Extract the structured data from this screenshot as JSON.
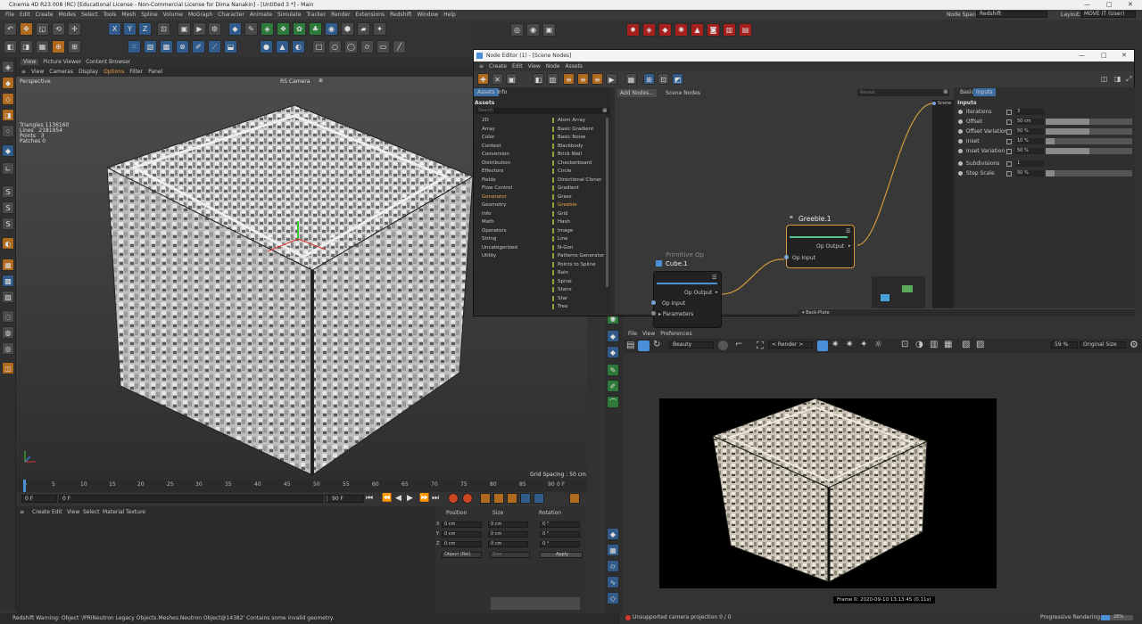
{
  "titlebar": {
    "title": "Cinema 4D R23.008 (RC) [Educational License - Non-Commercial License for Dima Nanakin] - [Untitled 3 *] - Main"
  },
  "menubar": {
    "items": [
      "File",
      "Edit",
      "Create",
      "Modes",
      "Select",
      "Tools",
      "Mesh",
      "Spline",
      "Volume",
      "MoGraph",
      "Character",
      "Animate",
      "Simulate",
      "Tracker",
      "Render",
      "Extensions",
      "Redshift",
      "Window",
      "Help"
    ],
    "node_space_label": "Node Space:",
    "node_space_value": "Redshift",
    "layout_label": "Layout:",
    "layout_value": "MOVE IT (User)"
  },
  "toolbar": {
    "axis_x": "X",
    "axis_y": "Y",
    "axis_z": "Z"
  },
  "viewport": {
    "tabs": [
      "View",
      "Picture Viewer",
      "Content Browser"
    ],
    "menu": [
      "View",
      "Cameras",
      "Display",
      "Options",
      "Filter",
      "Panel"
    ],
    "projection": "Perspective",
    "camera": "RS Camera",
    "stats": {
      "triangles_label": "Triangles",
      "triangles": "1136160",
      "lines_label": "Lines",
      "lines": "2181954",
      "points_label": "Points",
      "points": "3",
      "patches_label": "Patches",
      "patches": "0"
    },
    "grid_spacing": "Grid Spacing : 50 cm"
  },
  "timeline": {
    "ticks": [
      "0",
      "5",
      "10",
      "15",
      "20",
      "25",
      "30",
      "35",
      "40",
      "45",
      "50",
      "55",
      "60",
      "65",
      "70",
      "75",
      "80",
      "85",
      "90"
    ],
    "current_frame": "0 F",
    "start": "0 F",
    "min": "0 F",
    "max": "90 F",
    "end": "90 F"
  },
  "manager": {
    "menu": [
      "Create",
      "Edit",
      "View",
      "Select",
      "Material",
      "Texture"
    ]
  },
  "coords": {
    "headers": [
      "Position",
      "Size",
      "Rotation"
    ],
    "x_pos": "0 cm",
    "y_pos": "0 cm",
    "z_pos": "0 cm",
    "x_size": "0 cm",
    "y_size": "0 cm",
    "z_size": "0 cm",
    "h_rot": "0 °",
    "p_rot": "0 °",
    "b_rot": "0 °",
    "mode": "Object (Rel)",
    "size_mode": "Size",
    "apply": "Apply"
  },
  "statusbar": {
    "message": "Redshift Warning: Object '/PRINeutron Legacy Objects.Meshes.Neutron Object@14382' Contains some invalid geometry."
  },
  "node_editor": {
    "title": "Node Editor (1) - [Scene Nodes]",
    "menu": [
      "Create",
      "Edit",
      "View",
      "Node",
      "Assets"
    ],
    "asset_tabs": [
      "Assets",
      "Info"
    ],
    "assets_header": "Assets",
    "search_placeholder": "Search",
    "categories": [
      "2D",
      "Array",
      "Color",
      "Context",
      "Conversion",
      "Distribution",
      "Effectors",
      "Fields",
      "Flow Control",
      "Generator",
      "Geometry",
      "Info",
      "Math",
      "Operators",
      "String",
      "Uncategorized",
      "Utility"
    ],
    "items": [
      "Atom Array",
      "Basic Gradient",
      "Basic Noise",
      "Blackbody",
      "Brick Wall",
      "Checkerboard",
      "Circle",
      "Directional Cloner",
      "Gradient",
      "Grass",
      "Greeble",
      "Grid",
      "Hash",
      "Image",
      "Line",
      "N-Gon",
      "Patterns Generator",
      "Points to Spline",
      "Rain",
      "Spiral",
      "Stairs",
      "Star",
      "Tree"
    ],
    "graph_buttons": [
      "Add Nodes...",
      "Scene Nodes"
    ],
    "reveal_placeholder": "Reveal",
    "scene_port": "Scene",
    "cube_node": {
      "type": "Primitive Op",
      "name": "Cube.1",
      "output": "Op Output",
      "input": "Op Input",
      "params": "Parameters"
    },
    "greeble_node": {
      "name": "Greeble.1",
      "output": "Op Output",
      "input": "Op Input"
    },
    "backplate": "Back-Plate",
    "attr_tabs": [
      "Basic",
      "Inputs"
    ],
    "inputs_header": "Inputs",
    "attributes": [
      {
        "label": "Iterations",
        "value": "3",
        "fill": 0
      },
      {
        "label": "Offset",
        "value": "50 cm",
        "fill": 0.5
      },
      {
        "label": "Offset Variation",
        "value": "50 %",
        "fill": 0.5
      },
      {
        "label": "Inset",
        "value": "10 %",
        "fill": 0.1
      },
      {
        "label": "Inset Variation",
        "value": "50 %",
        "fill": 0.5
      },
      {
        "label": "Subdivisions",
        "value": "1",
        "fill": 0
      },
      {
        "label": "Step Scale",
        "value": "50 %",
        "fill": 0.1
      }
    ]
  },
  "render_view": {
    "menu": [
      "File",
      "View",
      "Preferences"
    ],
    "aov": "Beauty",
    "render_mode": "< Render >",
    "zoom": "59 %",
    "size": "Original Size",
    "frame_info": "Frame 0:  2020-09-10  13:13:45  (0.11s)",
    "status": "Unsupported camera projection 0 / 0",
    "progress": "Progressive Rendering...",
    "progress_pct": "28%"
  }
}
